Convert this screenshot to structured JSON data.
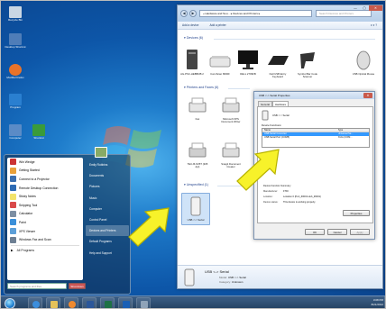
{
  "desktop": {
    "icons": [
      {
        "label": "Recycle Bin",
        "color": "#c9d6e3"
      },
      {
        "label": "Desktop Shortcut",
        "color": "#4f7db8"
      },
      {
        "label": "Mozilla Firefox",
        "color": "#e8732a"
      },
      {
        "label": "Program",
        "color": "#2a7fd0"
      },
      {
        "label": "Computer",
        "color": "#5b8bc6"
      },
      {
        "label": "Shortcut",
        "color": "#3a9b3a"
      }
    ]
  },
  "start_menu": {
    "programs": [
      {
        "label": "Win Wedge",
        "color": "#c33"
      },
      {
        "label": "Getting Started",
        "color": "#e9a13b"
      },
      {
        "label": "Connect to a Projector",
        "color": "#3b6fb0"
      },
      {
        "label": "Remote Desktop Connection",
        "color": "#2d6bb4"
      },
      {
        "label": "Sticky Notes",
        "color": "#f2e36b"
      },
      {
        "label": "Snipping Tool",
        "color": "#d94a4a"
      },
      {
        "label": "Calculator",
        "color": "#7c8ea3"
      },
      {
        "label": "Paint",
        "color": "#3a8fd9"
      },
      {
        "label": "XPS Viewer",
        "color": "#5c9fd8"
      },
      {
        "label": "Windows Fax and Scan",
        "color": "#6d7f93"
      }
    ],
    "all_programs": "All Programs",
    "search_placeholder": "Search programs and files",
    "shutdown_label": "Shut down",
    "right_items": [
      "Emily Robbins",
      "Documents",
      "Pictures",
      "Music",
      "Computer",
      "Control Panel",
      "Devices and Printers",
      "Default Programs",
      "Help and Support"
    ],
    "highlighted_item": "Devices and Printers"
  },
  "taskbar": {
    "pinned": [
      {
        "name": "ie-icon",
        "color": "#3c8edc"
      },
      {
        "name": "explorer-icon",
        "color": "#e5c25a"
      },
      {
        "name": "media-player-icon",
        "color": "#f08a2e"
      },
      {
        "name": "app-icon",
        "color": "#2b579a"
      },
      {
        "name": "excel-icon",
        "color": "#1e7145"
      },
      {
        "name": "outlook-icon",
        "color": "#1a5fb4"
      },
      {
        "name": "devices-icon",
        "color": "#8fa3b8"
      }
    ],
    "time": "3:08 PM",
    "date": "8/21/2012"
  },
  "explorer": {
    "address": "« Hardware and Sou... ▸ Devices and Printers ▸",
    "search_placeholder": "Search Devices and Printers",
    "toolbar": [
      "Add a device",
      "Add a printer"
    ],
    "groups": {
      "devices": "Devices (6)",
      "printers": "Printers and Faxes (6)",
      "unspecified": "Unspecified (1)"
    },
    "devices": [
      "AG-PSC-HEBBOB 2",
      "ConnScan 8000F",
      "DELL 2709FB",
      "Dell USB Entry Keyboard",
      "Symbol Bar Code Scanner",
      "USB Optical Mouse"
    ],
    "printers": [
      "Fax",
      "Microsoft XPS Document Writer",
      "TEC-B-SX5T (305 dpi)",
      "Snagit Document Creator"
    ],
    "unspecified": [
      "USB <-> Serial"
    ],
    "details": {
      "name": "USB <-> Serial",
      "model_label": "Model:",
      "model": "USB <-> Serial",
      "category_label": "Category:",
      "category": "Unknown"
    }
  },
  "properties": {
    "title": "USB <-> Serial Properties",
    "tabs": [
      "General",
      "Hardware"
    ],
    "device_name": "USB <-> Serial",
    "functions_label": "Device Functions:",
    "columns": [
      "Name",
      "Type"
    ],
    "rows": [
      {
        "name": "USB Serial Converter",
        "type": "Universal Se..."
      },
      {
        "name": "USB Serial Port (COM5)",
        "type": "Ports (COM..."
      }
    ],
    "summary_title": "Device Function Summary",
    "summary": [
      {
        "label": "Manufacturer:",
        "value": "FTDI"
      },
      {
        "label": "Location:",
        "value": "Location 0 (Port_#0001.Hub_#0001)"
      },
      {
        "label": "Device status:",
        "value": "This device is working properly."
      }
    ],
    "buttons": {
      "properties": "Properties",
      "ok": "OK",
      "cancel": "Cancel",
      "apply": "Apply"
    }
  },
  "colors": {
    "arrow": "#f7f22a",
    "accent": "#1e3f8a"
  }
}
